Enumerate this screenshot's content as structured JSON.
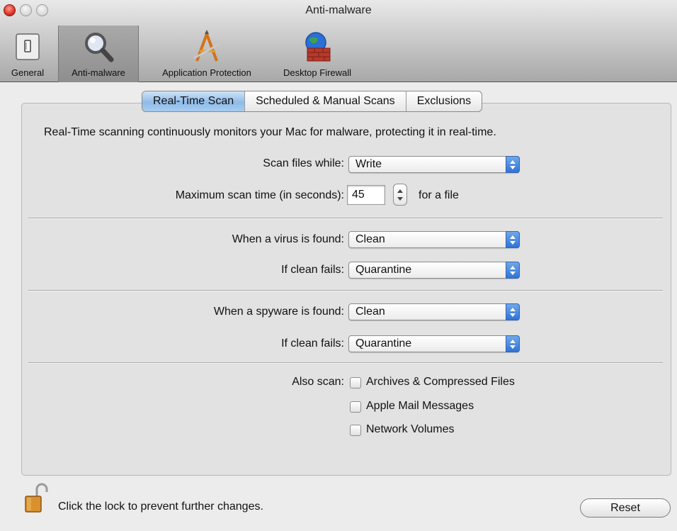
{
  "window": {
    "title": "Anti-malware"
  },
  "toolbar": {
    "items": [
      {
        "label": "General",
        "icon": "switch-icon"
      },
      {
        "label": "Anti-malware",
        "icon": "magnifier-icon",
        "selected": true
      },
      {
        "label": "Application Protection",
        "icon": "app-protection-icon"
      },
      {
        "label": "Desktop Firewall",
        "icon": "firewall-globe-icon"
      }
    ]
  },
  "tabs": [
    {
      "label": "Real-Time Scan",
      "active": true
    },
    {
      "label": "Scheduled & Manual Scans"
    },
    {
      "label": "Exclusions"
    }
  ],
  "description": "Real-Time scanning continuously monitors your Mac for malware, protecting it in real-time.",
  "settings": {
    "scan_files_while": {
      "label": "Scan files while:",
      "value": "Write"
    },
    "max_scan_time": {
      "label": "Maximum scan time (in seconds):",
      "value": "45",
      "suffix": "for a file"
    },
    "virus_found": {
      "label": "When a virus is found:",
      "value": "Clean"
    },
    "virus_clean_fails": {
      "label": "If clean fails:",
      "value": "Quarantine"
    },
    "spyware_found": {
      "label": "When a spyware is found:",
      "value": "Clean"
    },
    "spyware_clean_fails": {
      "label": "If clean fails:",
      "value": "Quarantine"
    },
    "also_scan": {
      "label": "Also scan:",
      "options": [
        {
          "label": "Archives & Compressed Files",
          "checked": false
        },
        {
          "label": "Apple Mail Messages",
          "checked": false
        },
        {
          "label": "Network Volumes",
          "checked": false
        }
      ]
    }
  },
  "footer": {
    "lock_text": "Click the lock to prevent further changes.",
    "reset_label": "Reset"
  },
  "colors": {
    "accent_blue": "#2f73d9",
    "active_tab": "#8fbbe8",
    "close_button": "#e2382c"
  }
}
